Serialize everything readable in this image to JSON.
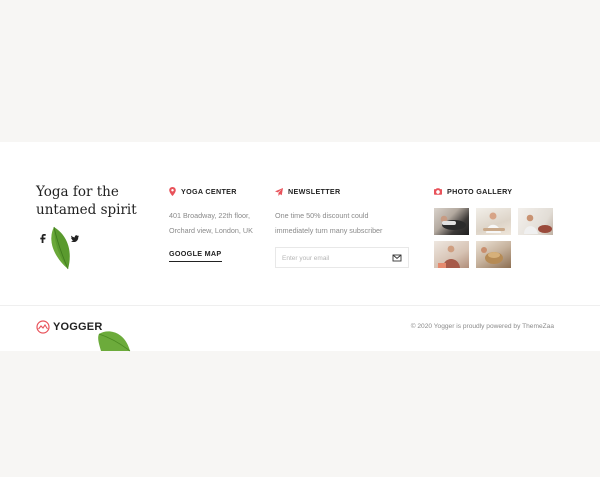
{
  "footer": {
    "tagline": "Yoga for the untamed spirit",
    "social": [
      {
        "name": "facebook-icon",
        "glyph": "f"
      },
      {
        "name": "instagram-icon",
        "glyph": "◎"
      },
      {
        "name": "twitter-icon",
        "glyph": "🐦"
      }
    ],
    "yoga_center": {
      "heading": "YOGA CENTER",
      "icon": "map-pin-icon",
      "address_line1": "401 Broadway, 22th floor,",
      "address_line2": "Orchard view, London, UK",
      "map_link": "GOOGLE MAP"
    },
    "newsletter": {
      "heading": "NEWSLETTER",
      "icon": "paper-plane-icon",
      "text": "One time 50% discount could immediately turn many subscriber",
      "email_placeholder": "Enter your email",
      "submit_icon": "envelope-icon"
    },
    "gallery": {
      "heading": "PHOTO GALLERY",
      "icon": "camera-icon",
      "photos": [
        "yoga-photo-1",
        "yoga-photo-2",
        "yoga-photo-3",
        "yoga-photo-4",
        "yoga-photo-5"
      ]
    },
    "brand": {
      "logo_text": "YOGGER"
    },
    "copyright": "© 2020 Yogger is proudly powered by ThemeZaa"
  },
  "colors": {
    "accent": "#e8525a",
    "text_dark": "#222222",
    "text_muted": "#8a8a8a",
    "page_bg": "#f7f6f4",
    "leaf_green": "#5a9a2e"
  }
}
